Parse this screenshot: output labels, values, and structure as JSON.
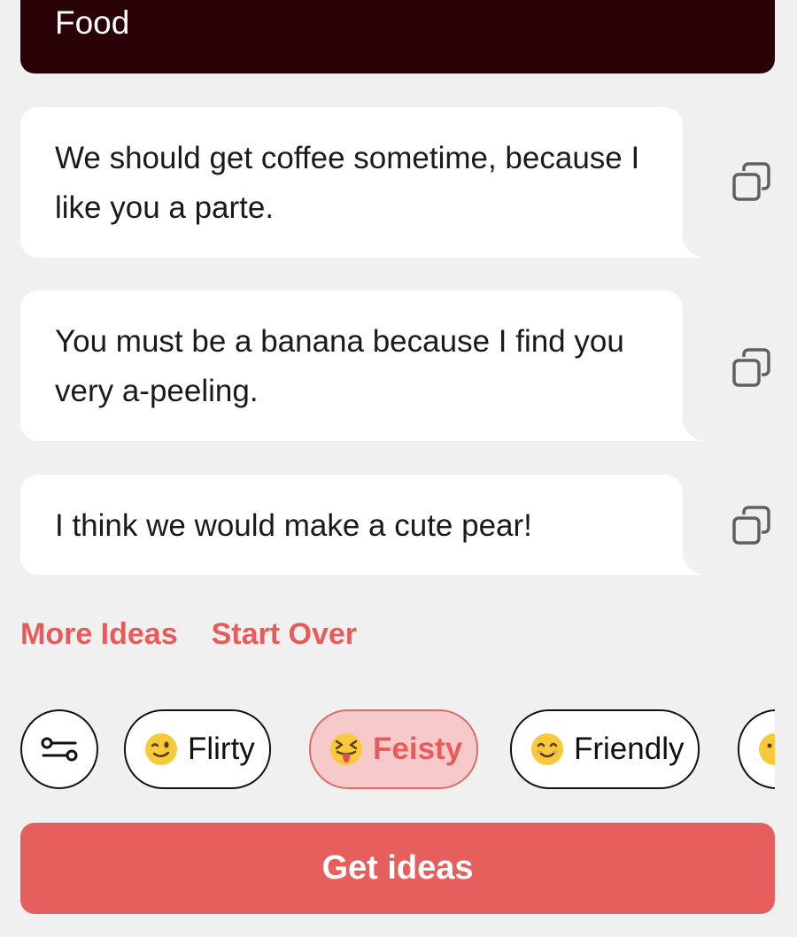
{
  "topic": {
    "label": "Food"
  },
  "ideas": [
    {
      "text": "We should get coffee sometime, because I like you a parte."
    },
    {
      "text": "You must be a banana because I find you very a-peeling."
    },
    {
      "text": "I think we would make a cute pear!"
    }
  ],
  "actions": {
    "more_ideas": "More Ideas",
    "start_over": "Start Over"
  },
  "tones": {
    "filter_icon": "sliders-icon",
    "chips": [
      {
        "label": "Flirty",
        "emoji": "winking-face",
        "selected": false
      },
      {
        "label": "Feisty",
        "emoji": "squinting-face-with-tongue",
        "selected": true
      },
      {
        "label": "Friendly",
        "emoji": "smiling-face",
        "selected": false
      }
    ]
  },
  "cta": {
    "label": "Get ideas"
  },
  "colors": {
    "accent": "#e65f5d",
    "topic_bg": "#2a0306",
    "selected_chip_bg": "#f6caca",
    "page_bg": "#f0f0f0"
  }
}
